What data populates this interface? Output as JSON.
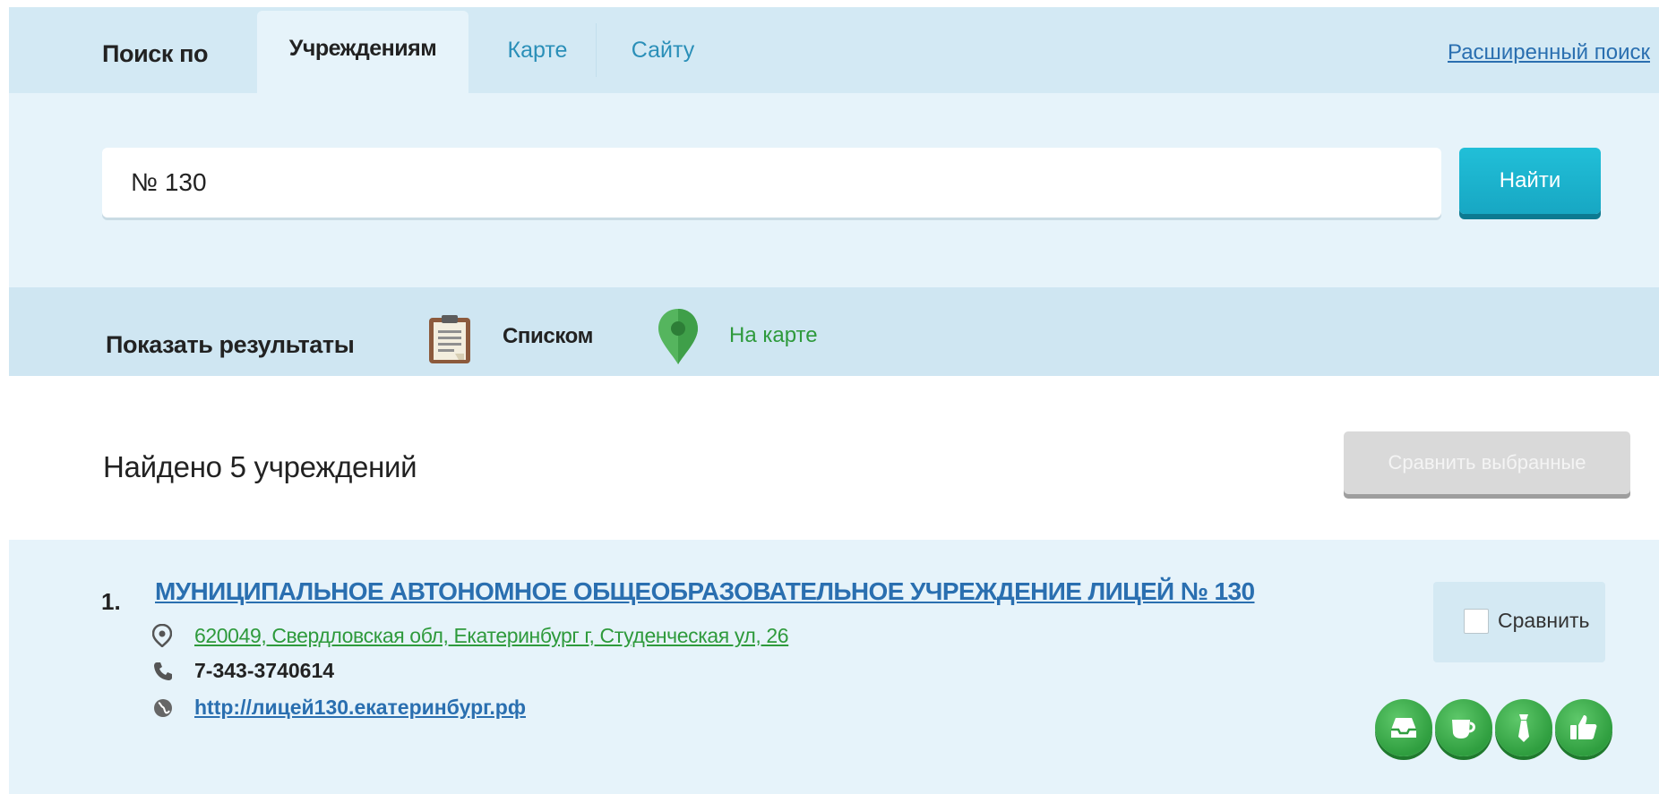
{
  "search": {
    "tabs_label": "Поиск по",
    "tabs": [
      {
        "label": "Учреждениям",
        "active": true
      },
      {
        "label": "Карте",
        "active": false
      },
      {
        "label": "Сайту",
        "active": false
      }
    ],
    "advanced_link": "Расширенный поиск",
    "query": "№ 130",
    "button_label": "Найти"
  },
  "view": {
    "label": "Показать результаты",
    "options": [
      {
        "label": "Списком",
        "icon": "clipboard-list-icon",
        "selected": true
      },
      {
        "label": "На карте",
        "icon": "map-pin-icon",
        "selected": false
      }
    ]
  },
  "results_header": {
    "found_text": "Найдено 5 учреждений",
    "compare_selected_label": "Сравнить выбранные"
  },
  "results": [
    {
      "number": "1.",
      "title": "МУНИЦИПАЛЬНОЕ АВТОНОМНОЕ ОБЩЕОБРАЗОВАТЕЛЬНОЕ УЧРЕЖДЕНИЕ ЛИЦЕЙ № 130",
      "address": "620049, Свердловская обл, Екатеринбург г, Студенческая ул, 26",
      "phone": "7-343-3740614",
      "website": "http://лицей130.екатеринбург.рф",
      "compare_label": "Сравнить",
      "compare_checked": false,
      "badges": [
        "inbox-icon",
        "cup-icon",
        "tie-icon",
        "thumbs-up-icon"
      ]
    }
  ],
  "colors": {
    "accent": "#17a7c3",
    "link": "#2a6fb0",
    "green": "#2e9a3c",
    "panel": "#e6f3fa"
  }
}
